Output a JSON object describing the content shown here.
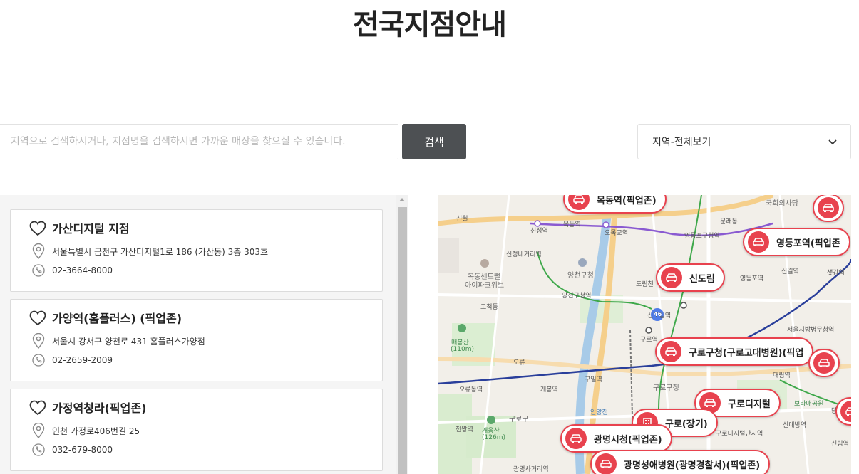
{
  "page_title": "전국지점안내",
  "search": {
    "placeholder": "지역으로 검색하시거나, 지점명을 검색하시면 가까운 매장을 찾으실 수 있습니다.",
    "button_label": "검색"
  },
  "region_select": {
    "selected": "지역-전체보기"
  },
  "stores": [
    {
      "name": "가산디지털 지점",
      "address": "서울특별시 금천구 가산디지털1로 186 (가산동) 3층 303호",
      "phone": "02-3664-8000"
    },
    {
      "name": "가양역(홈플러스) (픽업존)",
      "address": "서울시 강서구 양천로 431 홈플러스가양점",
      "phone": "02-2659-2009"
    },
    {
      "name": "가정역청라(픽업존)",
      "address": "인천 가정로406번길 25",
      "phone": "032-679-8000"
    }
  ],
  "map": {
    "markers": [
      {
        "label": "목동역(픽업존)",
        "icon": "car-icon"
      },
      {
        "label": "",
        "icon": "car-icon"
      },
      {
        "label": "영등포역(픽업존",
        "icon": "car-icon"
      },
      {
        "label": "신도림",
        "icon": "car-icon"
      },
      {
        "label": "구로구청(구로고대병원)(픽업",
        "icon": "car-icon"
      },
      {
        "label": "",
        "icon": "car-icon"
      },
      {
        "label": "구로디지털",
        "icon": "car-icon"
      },
      {
        "label": "",
        "icon": "car-icon"
      },
      {
        "label": "구로(장기)",
        "icon": "building-icon"
      },
      {
        "label": "광명시청(픽업존)",
        "icon": "car-icon"
      },
      {
        "label": "광명성애병원(광명경찰서)(픽업존)",
        "icon": "car-icon"
      }
    ],
    "labels": {
      "l1": "국회의사당",
      "l2": "신정역",
      "l3": "목동역",
      "l4": "오목교역",
      "l5": "영등포구청역",
      "l6": "신정네거리역",
      "l7": "양천구청",
      "l8": "목동센트럴",
      "l9": "아이파크위브",
      "l10": "양천구청역",
      "l11": "도림천",
      "l12": "신도림역",
      "l13": "매봉산",
      "l14": "(110m)",
      "l15": "오류",
      "l16": "오류동역",
      "l17": "개봉역",
      "l18": "구일역",
      "l19": "구로역",
      "l20": "구로구청",
      "l21": "구로구",
      "l22": "천왕역",
      "l23": "개웅산",
      "l24": "(126m)",
      "l25": "안양천",
      "l26": "광명사거리역",
      "l27": "영등포역",
      "l28": "신길역",
      "l29": "샛강역",
      "l30": "서울지방병무청역",
      "l31": "신대방역",
      "l32": "신림역",
      "l33": "신월",
      "l34": "문래동",
      "l35": "고척동",
      "l36": "46",
      "l37": "대림역",
      "l38": "구로디지털단지역",
      "l39": "보라매공원",
      "l40": "당곡"
    }
  }
}
